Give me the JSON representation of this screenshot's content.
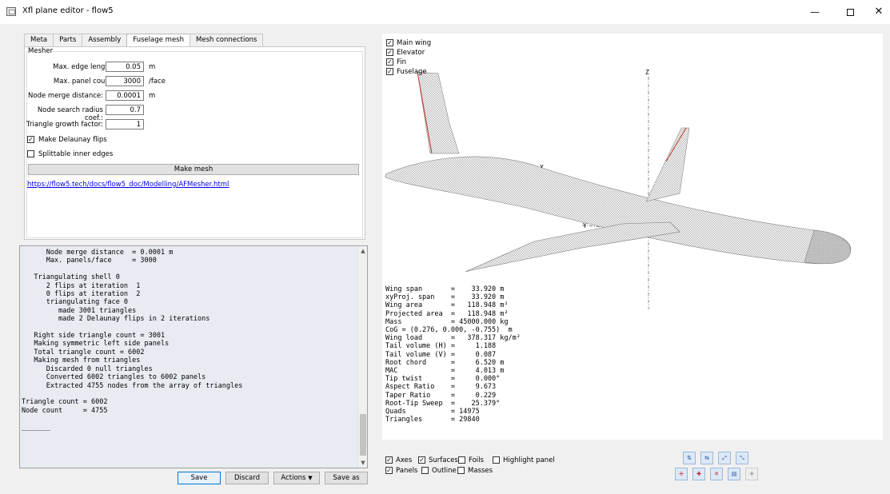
{
  "window": {
    "title": "Xfl plane editor - flow5",
    "minimize": "—",
    "close": "✕"
  },
  "tabs": [
    "Meta",
    "Parts",
    "Assembly",
    "Fuselage mesh",
    "Mesh connections"
  ],
  "mesher": {
    "group_label": "Mesher",
    "fields": [
      {
        "label": "Max. edge length:",
        "value": "0.05",
        "unit": "m"
      },
      {
        "label": "Max. panel count:",
        "value": "3000",
        "unit": "/face"
      },
      {
        "label": "Node merge distance:",
        "value": "0.0001",
        "unit": "m"
      },
      {
        "label": "Node search radius coef.:",
        "value": "0.7",
        "unit": ""
      },
      {
        "label": "Triangle growth factor:",
        "value": "1",
        "unit": ""
      }
    ],
    "delaunay_label": "Make Delaunay flips",
    "delaunay_checked": true,
    "splittable_label": "Splittable inner edges",
    "splittable_checked": false,
    "make_mesh_label": "Make mesh",
    "doc_link": "https://flow5.tech/docs/flow5_doc/Modelling/AFMesher.html"
  },
  "console_lines": [
    "      Node merge distance  = 0.0001 m",
    "      Max. panels/face     = 3000",
    "",
    "   Triangulating shell 0",
    "      2 flips at iteration  1",
    "      0 flips at iteration  2",
    "      triangulating face 0",
    "         made 3001 triangles",
    "         made 2 Delaunay flips in 2 iterations",
    "",
    "   Right side triangle count = 3001",
    "   Making symmetric left side panels",
    "   Total triangle count = 6002",
    "   Making mesh from triangles",
    "      Discarded 0 null triangles",
    "      Converted 6002 triangles to 6002 panels",
    "      Extracted 4755 nodes from the array of triangles",
    "",
    "Triangle count = 6002",
    "Node count     = 4755",
    "",
    "_______"
  ],
  "buttons": {
    "save": "Save",
    "discard": "Discard",
    "actions": "Actions",
    "actions_arrow": "▼",
    "save_as": "Save as"
  },
  "view_parts": [
    {
      "label": "Main wing",
      "checked": true
    },
    {
      "label": "Elevator",
      "checked": true
    },
    {
      "label": "Fin",
      "checked": true
    },
    {
      "label": "Fuselage",
      "checked": true
    }
  ],
  "axis_labels": {
    "x": "X",
    "y": "Y",
    "z": "Z"
  },
  "stats_lines": [
    "Wing span       =    33.920 m",
    "xyProj. span    =    33.920 m",
    "Wing area       =   118.948 m²",
    "Projected area  =   118.948 m²",
    "Mass            = 45000.000 kg",
    "CoG = (0.276, 0.000, -0.755)  m",
    "Wing load       =   378.317 kg/m²",
    "Tail volume (H) =     1.188",
    "Tail volume (V) =     0.087",
    "Root chord      =     6.520 m",
    "MAC             =     4.013 m",
    "Tip twist       =     0.000°",
    "Aspect Ratio    =     9.673",
    "Taper Ratio     =     0.229",
    "Root-Tip Sweep  =    25.379°",
    "Quads           = 14975",
    "Triangles       = 29840"
  ],
  "display_options": [
    {
      "label": "Axes",
      "checked": true
    },
    {
      "label": "Surfaces",
      "checked": true
    },
    {
      "label": "Foils",
      "checked": false
    },
    {
      "label": "Highlight panel",
      "checked": false
    },
    {
      "label": "Panels",
      "checked": true
    },
    {
      "label": "Outline",
      "checked": false
    },
    {
      "label": "Masses",
      "checked": false
    }
  ],
  "colors": {
    "console_bg": "#e8ecf2",
    "link": "#0000ee",
    "leading_edge": "#c0392b",
    "mesh": "#888888"
  }
}
